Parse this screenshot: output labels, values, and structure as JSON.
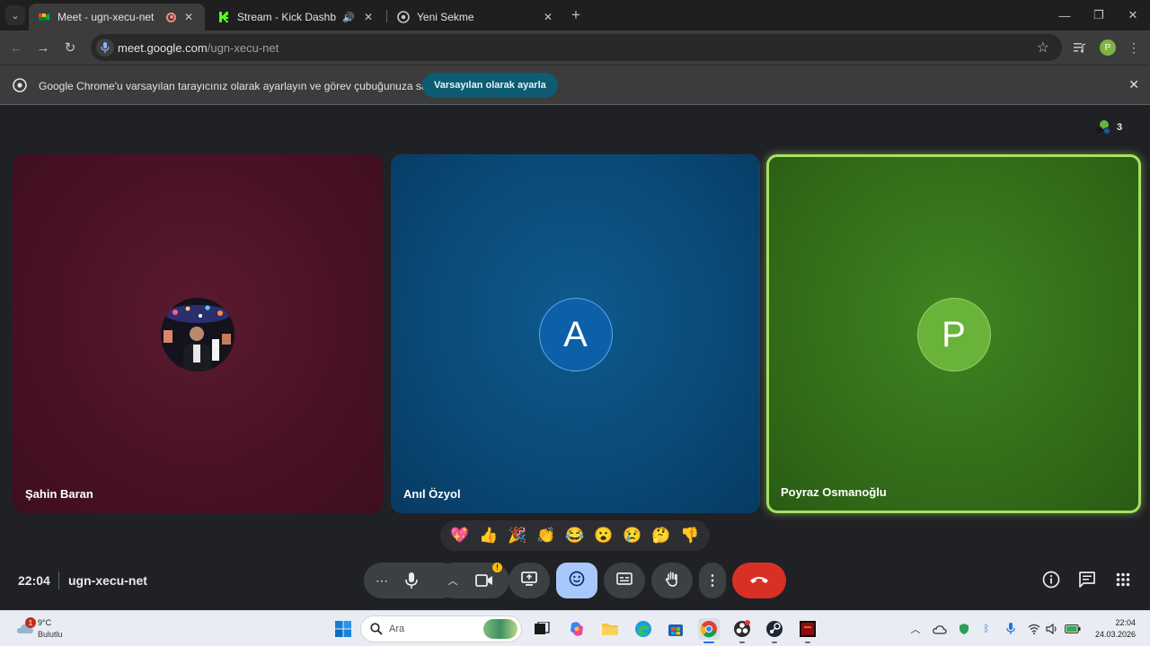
{
  "browser": {
    "tabs": [
      {
        "title": "Meet - ugn-xecu-net",
        "active": true
      },
      {
        "title": "Stream - Kick Dashboard",
        "active": false
      },
      {
        "title": "Yeni Sekme",
        "active": false
      }
    ],
    "url_host": "meet.google.com",
    "url_path": "/ugn-xecu-net",
    "profile_initial": "P",
    "infobar": {
      "text": "Google Chrome'u varsayılan tarayıcınız olarak ayarlayın ve görev çubuğunuza sabitleyin",
      "button_label": "Varsayılan olarak ayarla"
    }
  },
  "meet": {
    "participant_count": "3",
    "participants": [
      {
        "name": "Şahin Baran",
        "initial": "",
        "color": "#4a1225"
      },
      {
        "name": "Anıl Özyol",
        "initial": "A",
        "color": "#0a4a78"
      },
      {
        "name": "Poyraz Osmanoğlu",
        "initial": "P",
        "color": "#336f19",
        "speaking": true
      }
    ],
    "reactions": [
      "💖",
      "👍",
      "🎉",
      "👏",
      "😂",
      "😮",
      "😢",
      "🤔",
      "👎"
    ],
    "clock": "22:04",
    "meeting_code": "ugn-xecu-net",
    "icons": {
      "more": "more-horiz-icon",
      "mic": "mic-icon",
      "camera": "videocam-icon",
      "present": "present-icon",
      "emoji": "emoji-icon",
      "captions": "captions-icon",
      "hand": "raise-hand-icon",
      "options": "more-vert-icon",
      "leave": "call-end-icon",
      "info": "info-icon",
      "chat": "chat-icon",
      "activities": "apps-icon"
    },
    "colors": {
      "end_call": "#d93025",
      "emoji_active": "#a8c7fa",
      "speaking_border": "#a8e064"
    }
  },
  "taskbar": {
    "weather_temp": "9°C",
    "weather_condition": "Bulutlu",
    "weather_badge": "1",
    "search_placeholder": "Ara",
    "time": "22:04",
    "date": "24.03.2026"
  }
}
